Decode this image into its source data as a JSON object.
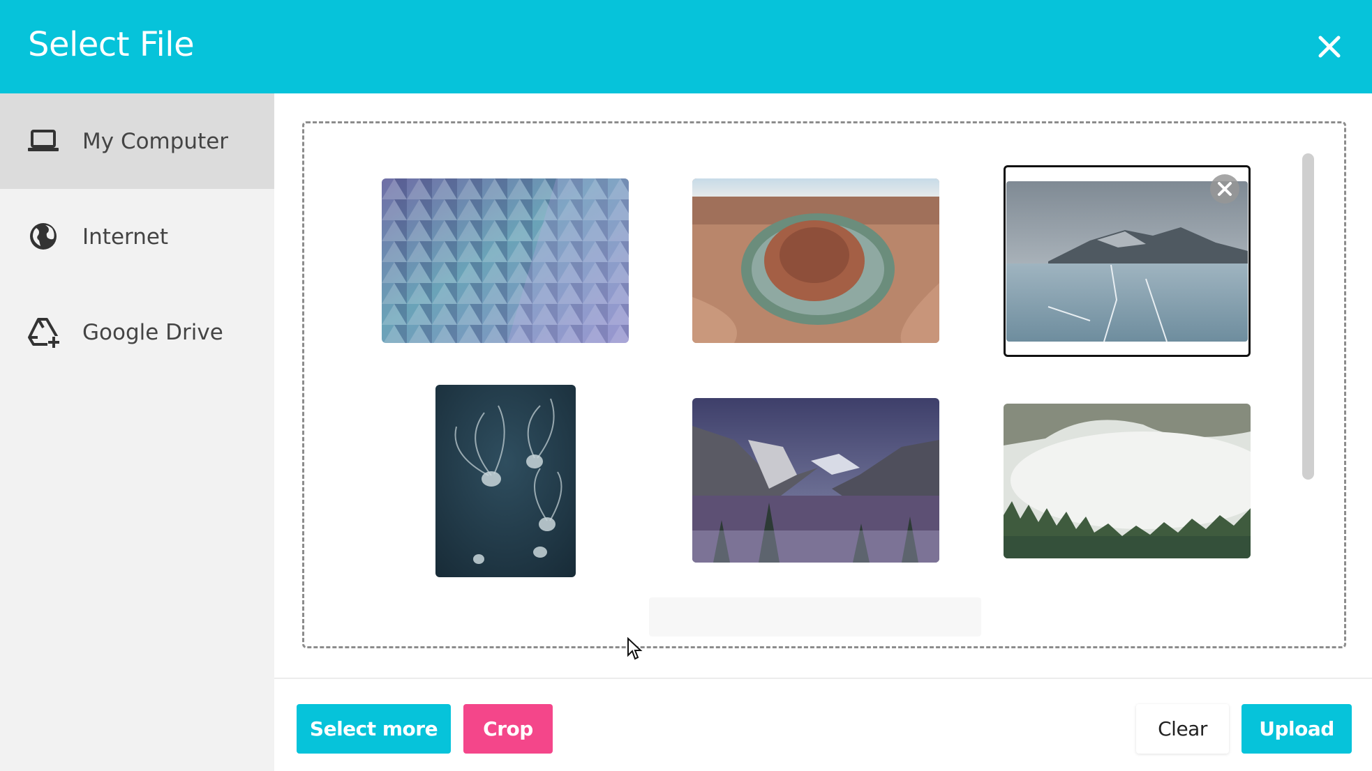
{
  "header": {
    "title": "Select File"
  },
  "sidebar": {
    "items": [
      {
        "label": "My Computer",
        "icon": "laptop-icon",
        "active": true
      },
      {
        "label": "Internet",
        "icon": "globe-icon",
        "active": false
      },
      {
        "label": "Google Drive",
        "icon": "google-drive-icon",
        "active": false
      }
    ]
  },
  "thumbnails": [
    {
      "subject": "geometric glass ceiling",
      "selected": false
    },
    {
      "subject": "horseshoe bend canyon",
      "selected": false
    },
    {
      "subject": "frozen lake and mountain",
      "selected": true
    },
    {
      "subject": "jellyfish",
      "selected": false
    },
    {
      "subject": "snowy valley",
      "selected": false
    },
    {
      "subject": "foggy forest",
      "selected": false
    }
  ],
  "footer": {
    "select_more_label": "Select more",
    "crop_label": "Crop",
    "clear_label": "Clear",
    "upload_label": "Upload"
  },
  "colors": {
    "brand": "#06c3da",
    "crop": "#f4468a",
    "sidebar_bg": "#f2f2f2",
    "sidebar_active": "#dcdcdc"
  }
}
